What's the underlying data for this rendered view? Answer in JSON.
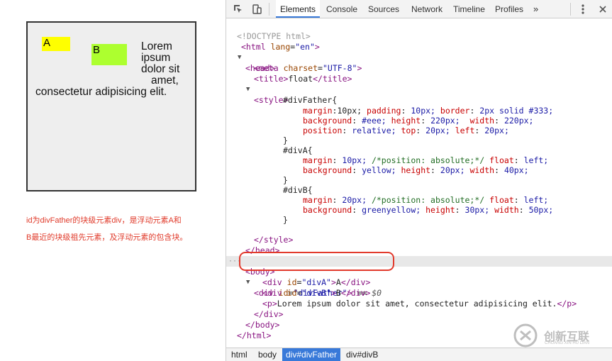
{
  "demo": {
    "box_a_label": "A",
    "box_b_label": "B",
    "lorem_lines": [
      "Lorem",
      "ipsum",
      "dolor sit",
      "amet,",
      "consectetur adipisicing elit."
    ],
    "caption_lines": [
      "id为divFather的块级元素div，是浮动元素A和",
      "B最近的块级祖先元素，及浮动元素的包含块。"
    ]
  },
  "devtools": {
    "tabs": [
      "Elements",
      "Console",
      "Sources",
      "Network",
      "Timeline",
      "Profiles"
    ],
    "active_tab": "Elements",
    "more_tabs_glyph": "»",
    "icons": [
      "inspect-icon",
      "device-mode-icon",
      "more-tabs-icon",
      "menu-icon",
      "close-icon"
    ],
    "code": {
      "doctype": "<!DOCTYPE html>",
      "html_open_tag": "<html",
      "lang_attr": "lang",
      "lang_val": "\"en\"",
      "close_bracket": ">",
      "head_open": "<head>",
      "meta_tag": "<meta",
      "charset_attr": "charset",
      "charset_val": "\"UTF-8\"",
      "title_open": "<title>",
      "title_text": "float",
      "title_close": "</title>",
      "style_open": "<style>",
      "sel_father": "#divFather{",
      "father_l1": [
        "margin",
        ":10px; ",
        "padding",
        ": ",
        "10px; ",
        "border",
        ": ",
        "2px solid #333;"
      ],
      "father_l2": [
        "background",
        ": ",
        "#eee; ",
        "height",
        ": ",
        "220px;  ",
        "width",
        ": ",
        "220px;"
      ],
      "father_l3": [
        "position",
        ": ",
        "relative; ",
        "top",
        ": ",
        "20px; ",
        "left",
        ": ",
        "20px;"
      ],
      "brace_close": "}",
      "sel_a": "#divA{",
      "a_l1": [
        "margin",
        ": ",
        "10px; ",
        "/*position: absolute;*/ ",
        "float",
        ": ",
        "left;"
      ],
      "a_l2": [
        "background",
        ": ",
        "yellow; ",
        "height",
        ": ",
        "20px; ",
        "width",
        ": ",
        "40px;"
      ],
      "sel_b": "#divB{",
      "b_l1": [
        "margin",
        ": ",
        "20px; ",
        "/*position: absolute;*/ ",
        "float",
        ": ",
        "left;"
      ],
      "b_l2": [
        "background",
        ": ",
        "greenyellow; ",
        "height",
        ": ",
        "30px; ",
        "width",
        ": ",
        "50px;"
      ],
      "style_close": "</style>",
      "head_close": "</head>",
      "body_open": "<body>",
      "div_open": "<div",
      "id_attr": "id",
      "father_val": "\"divFather\"",
      "eq_sel": " == ",
      "dollar0": "$0",
      "diva_val": "\"divA\"",
      "divA_text": "A",
      "divb_val": "\"divB\"",
      "divB_text": "B",
      "div_close": "</div>",
      "p_open": "<p>",
      "p_text": "Lorem ipsum dolor sit amet, consectetur adipisicing elit.",
      "p_close": "</p>",
      "body_close": "</body>",
      "html_close": "</html>",
      "ellipsis": "···"
    },
    "breadcrumb": [
      "html",
      "body",
      "div#divFather",
      "div#divB"
    ],
    "active_crumb": "div#divFather"
  },
  "watermark": {
    "name": "创新互联",
    "sub": "CHUANG XIN HU LIAN"
  },
  "colors": {
    "accent": "#3879d9",
    "highlight_oval": "#e23a2c",
    "caption": "#e03a2a",
    "box_a": "yellow",
    "box_b": "greenyellow"
  }
}
